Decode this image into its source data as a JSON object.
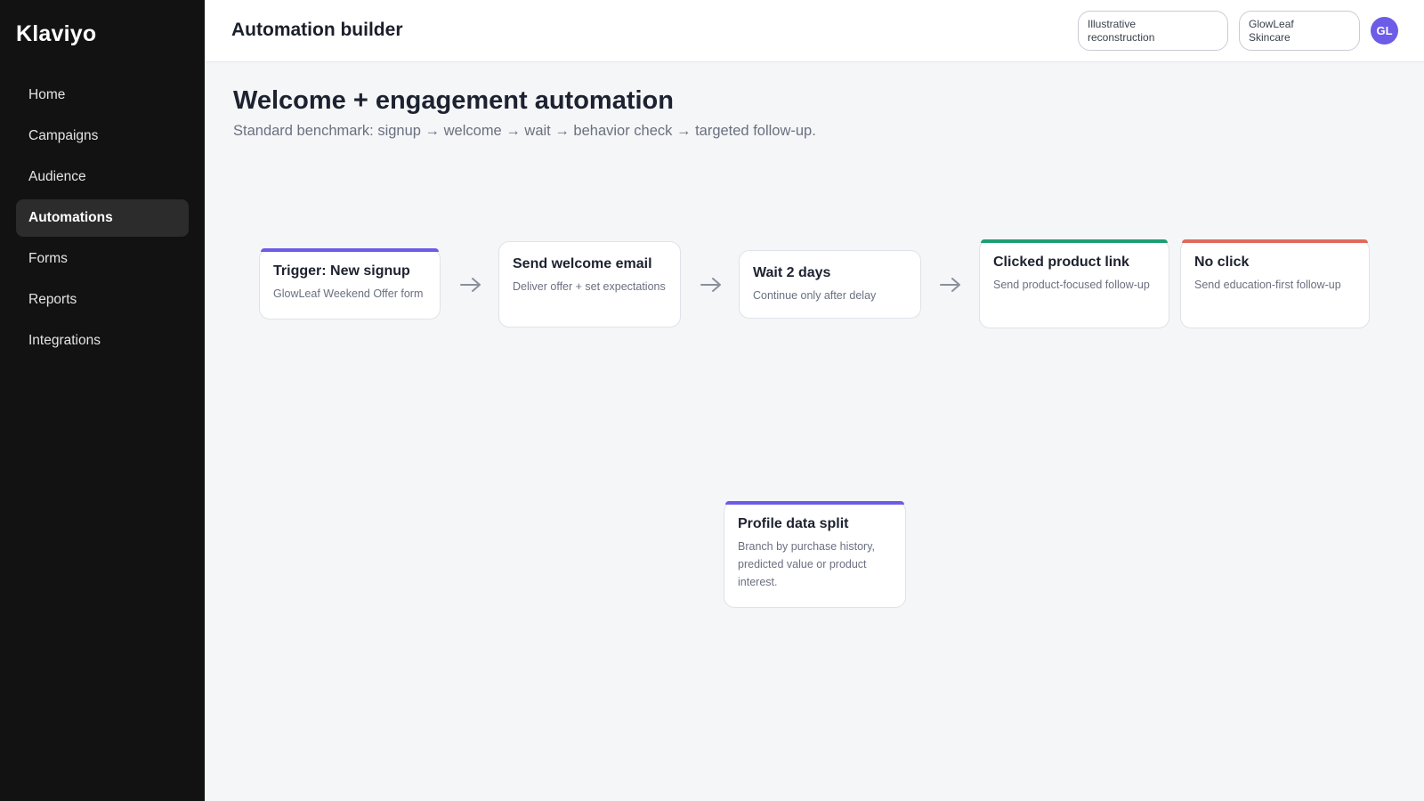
{
  "app": {
    "name": "Klaviyo"
  },
  "sidebar": {
    "items": [
      {
        "label": "Home",
        "active": false
      },
      {
        "label": "Campaigns",
        "active": false
      },
      {
        "label": "Audience",
        "active": false
      },
      {
        "label": "Automations",
        "active": true
      },
      {
        "label": "Forms",
        "active": false
      },
      {
        "label": "Reports",
        "active": false
      },
      {
        "label": "Integrations",
        "active": false
      }
    ]
  },
  "header": {
    "title": "Automation builder",
    "chips": [
      "Illustrative reconstruction",
      "GlowLeaf Skincare"
    ],
    "avatar_initials": "GL"
  },
  "main": {
    "title": "Welcome + engagement automation",
    "subtitle": "Standard benchmark: signup → welcome → wait → behavior check → targeted follow-up."
  },
  "flow": {
    "nodes": [
      {
        "title": "Trigger: New signup",
        "description": "GlowLeaf Weekend Offer form",
        "accent": "#6c5ce7"
      },
      {
        "title": "Send welcome email",
        "description": "Deliver offer + set expectations",
        "accent": ""
      },
      {
        "title": "Wait 2 days",
        "description": "Continue only after delay",
        "accent": ""
      },
      {
        "title": "Clicked product link",
        "description": "Send product-focused follow-up",
        "accent": "#1f9d74"
      },
      {
        "title": "No click",
        "description": "Send education-first follow-up",
        "accent": "#e06a5c"
      },
      {
        "title": "Profile data split",
        "description": "Branch by purchase history, predicted value or product interest.",
        "accent": "#6c5ce7"
      }
    ]
  },
  "colors": {
    "sidebar_bg": "#121212",
    "accent_purple": "#6c5ce7",
    "accent_green": "#1f9d74",
    "accent_red": "#e06a5c"
  },
  "icons": {
    "flow_arrow": "arrow-right-icon"
  }
}
